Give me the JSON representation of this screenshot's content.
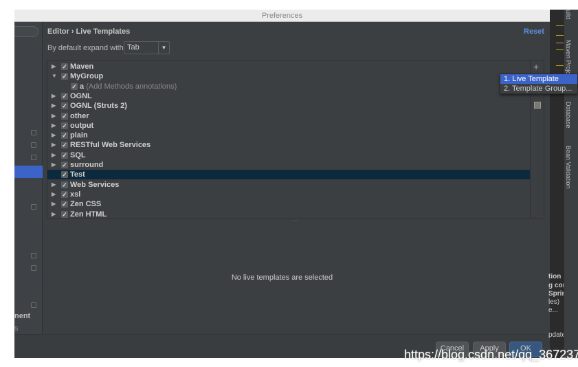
{
  "window": {
    "title": "Preferences"
  },
  "breadcrumb": "Editor › Live Templates",
  "reset_label": "Reset",
  "expand": {
    "label": "By default expand with",
    "value": "Tab"
  },
  "sidebar": {
    "partial_texts": [
      "nent",
      "s"
    ]
  },
  "tree": [
    {
      "label": "Maven",
      "expanded": false,
      "checked": true
    },
    {
      "label": "MyGroup",
      "expanded": true,
      "checked": true
    },
    {
      "label": "a",
      "desc": "(Add Methods annotations)",
      "child": true,
      "checked": true
    },
    {
      "label": "OGNL",
      "expanded": false,
      "checked": true
    },
    {
      "label": "OGNL (Struts 2)",
      "expanded": false,
      "checked": true
    },
    {
      "label": "other",
      "expanded": false,
      "checked": true
    },
    {
      "label": "output",
      "expanded": false,
      "checked": true
    },
    {
      "label": "plain",
      "expanded": false,
      "checked": true
    },
    {
      "label": "RESTful Web Services",
      "expanded": false,
      "checked": true
    },
    {
      "label": "SQL",
      "expanded": false,
      "checked": true
    },
    {
      "label": "surround",
      "expanded": false,
      "checked": true
    },
    {
      "label": "Test",
      "leaf": true,
      "checked": true,
      "selected": true
    },
    {
      "label": "Web Services",
      "expanded": false,
      "checked": true
    },
    {
      "label": "xsl",
      "expanded": false,
      "checked": true
    },
    {
      "label": "Zen CSS",
      "expanded": false,
      "checked": true
    },
    {
      "label": "Zen HTML",
      "expanded": false,
      "checked": true
    }
  ],
  "empty_message": "No live templates are selected",
  "add_menu": [
    "1. Live Template",
    "2. Template Group..."
  ],
  "buttons": {
    "cancel": "Cancel",
    "apply": "Apply",
    "ok": "OK"
  },
  "ide": {
    "tool_windows": [
      "uild",
      "Maven Proje",
      "Database",
      "Bean Validation"
    ],
    "side_text": [
      "tion",
      "g con",
      "Sprir",
      "les)",
      "e...",
      "pdate"
    ]
  },
  "watermark": "https://blog.csdn.net/qq_36723759",
  "colors": {
    "accent": "#3c64c8",
    "selection": "#0d293e",
    "link": "#5c8fe0"
  }
}
